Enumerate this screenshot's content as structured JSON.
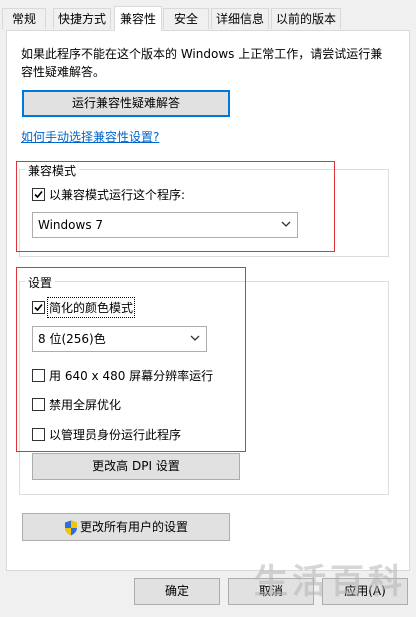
{
  "tabs": [
    {
      "label": "常规"
    },
    {
      "label": "快捷方式"
    },
    {
      "label": "兼容性"
    },
    {
      "label": "安全"
    },
    {
      "label": "详细信息"
    },
    {
      "label": "以前的版本"
    }
  ],
  "intro_text": "如果此程序不能在这个版本的 Windows 上正常工作，请尝试运行兼容性疑难解答。",
  "troubleshoot_button": "运行兼容性疑难解答",
  "manual_link": "如何手动选择兼容性设置?",
  "compat_mode": {
    "title": "兼容模式",
    "checkbox_label": "以兼容模式运行这个程序:",
    "checked": true,
    "selected_os": "Windows 7"
  },
  "settings": {
    "title": "设置",
    "reduced_color": {
      "label": "简化的颜色模式",
      "checked": true
    },
    "color_depth": "8 位(256)色",
    "run_640": {
      "label": "用 640 x 480 屏幕分辨率运行",
      "checked": false
    },
    "disable_fullscreen": {
      "label": "禁用全屏优化",
      "checked": false
    },
    "run_admin": {
      "label": "以管理员身份运行此程序",
      "checked": false
    },
    "dpi_button": "更改高 DPI 设置"
  },
  "all_users_button": "更改所有用户的设置",
  "footer": {
    "ok": "确定",
    "cancel": "取消",
    "apply": "应用(A)"
  },
  "watermark": "生活百科",
  "colors": {
    "accent": "#0078d7",
    "highlight_box": "#e0343a",
    "link": "#0066cc"
  }
}
